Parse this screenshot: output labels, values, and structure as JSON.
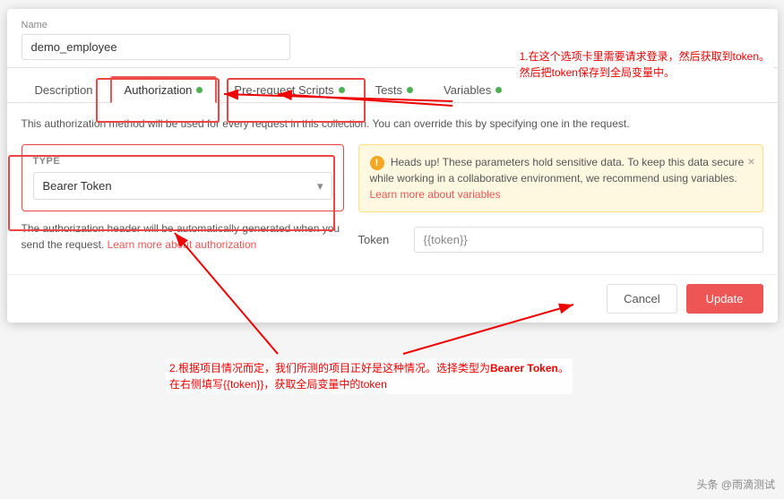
{
  "modal": {
    "name_label": "Name",
    "name_value": "demo_employee",
    "tabs": [
      {
        "label": "Description",
        "active": false,
        "has_dot": false,
        "dot_color": ""
      },
      {
        "label": "Authorization",
        "active": true,
        "has_dot": true,
        "dot_color": "#4caf50"
      },
      {
        "label": "Pre-request Scripts",
        "active": false,
        "has_dot": true,
        "dot_color": "#4caf50"
      },
      {
        "label": "Tests",
        "active": false,
        "has_dot": true,
        "dot_color": "#4caf50"
      },
      {
        "label": "Variables",
        "active": false,
        "has_dot": true,
        "dot_color": "#4caf50"
      }
    ],
    "description": "This authorization method will be used for every request in this collection. You can override this by specifying one in the request.",
    "type_label": "TYPE",
    "type_value": "Bearer Token",
    "auth_note": "The authorization header will be automatically generated when you send the request. Learn more about authorization",
    "auth_note_link": "Learn more about authorization",
    "warning_text": "Heads up! These parameters hold sensitive data. To keep this data secure while working in a collaborative environment, we recommend using variables.",
    "warning_link": "Learn more about variables",
    "token_label": "Token",
    "token_placeholder": "{{token}}",
    "cancel_label": "Cancel",
    "update_label": "Update"
  },
  "annotations": {
    "note1": "1.在这个选项卡里需要请求登录，然后获取到token。\n然后把token保存到全局变量中。",
    "note2": "2.根据项目情况而定，我们所测的项目正好是这种情况。选择类型为Bearer Token。\n在右侧填写{{token}}，获取全局变量中的token"
  },
  "watermark": "头条 @雨滴测试"
}
